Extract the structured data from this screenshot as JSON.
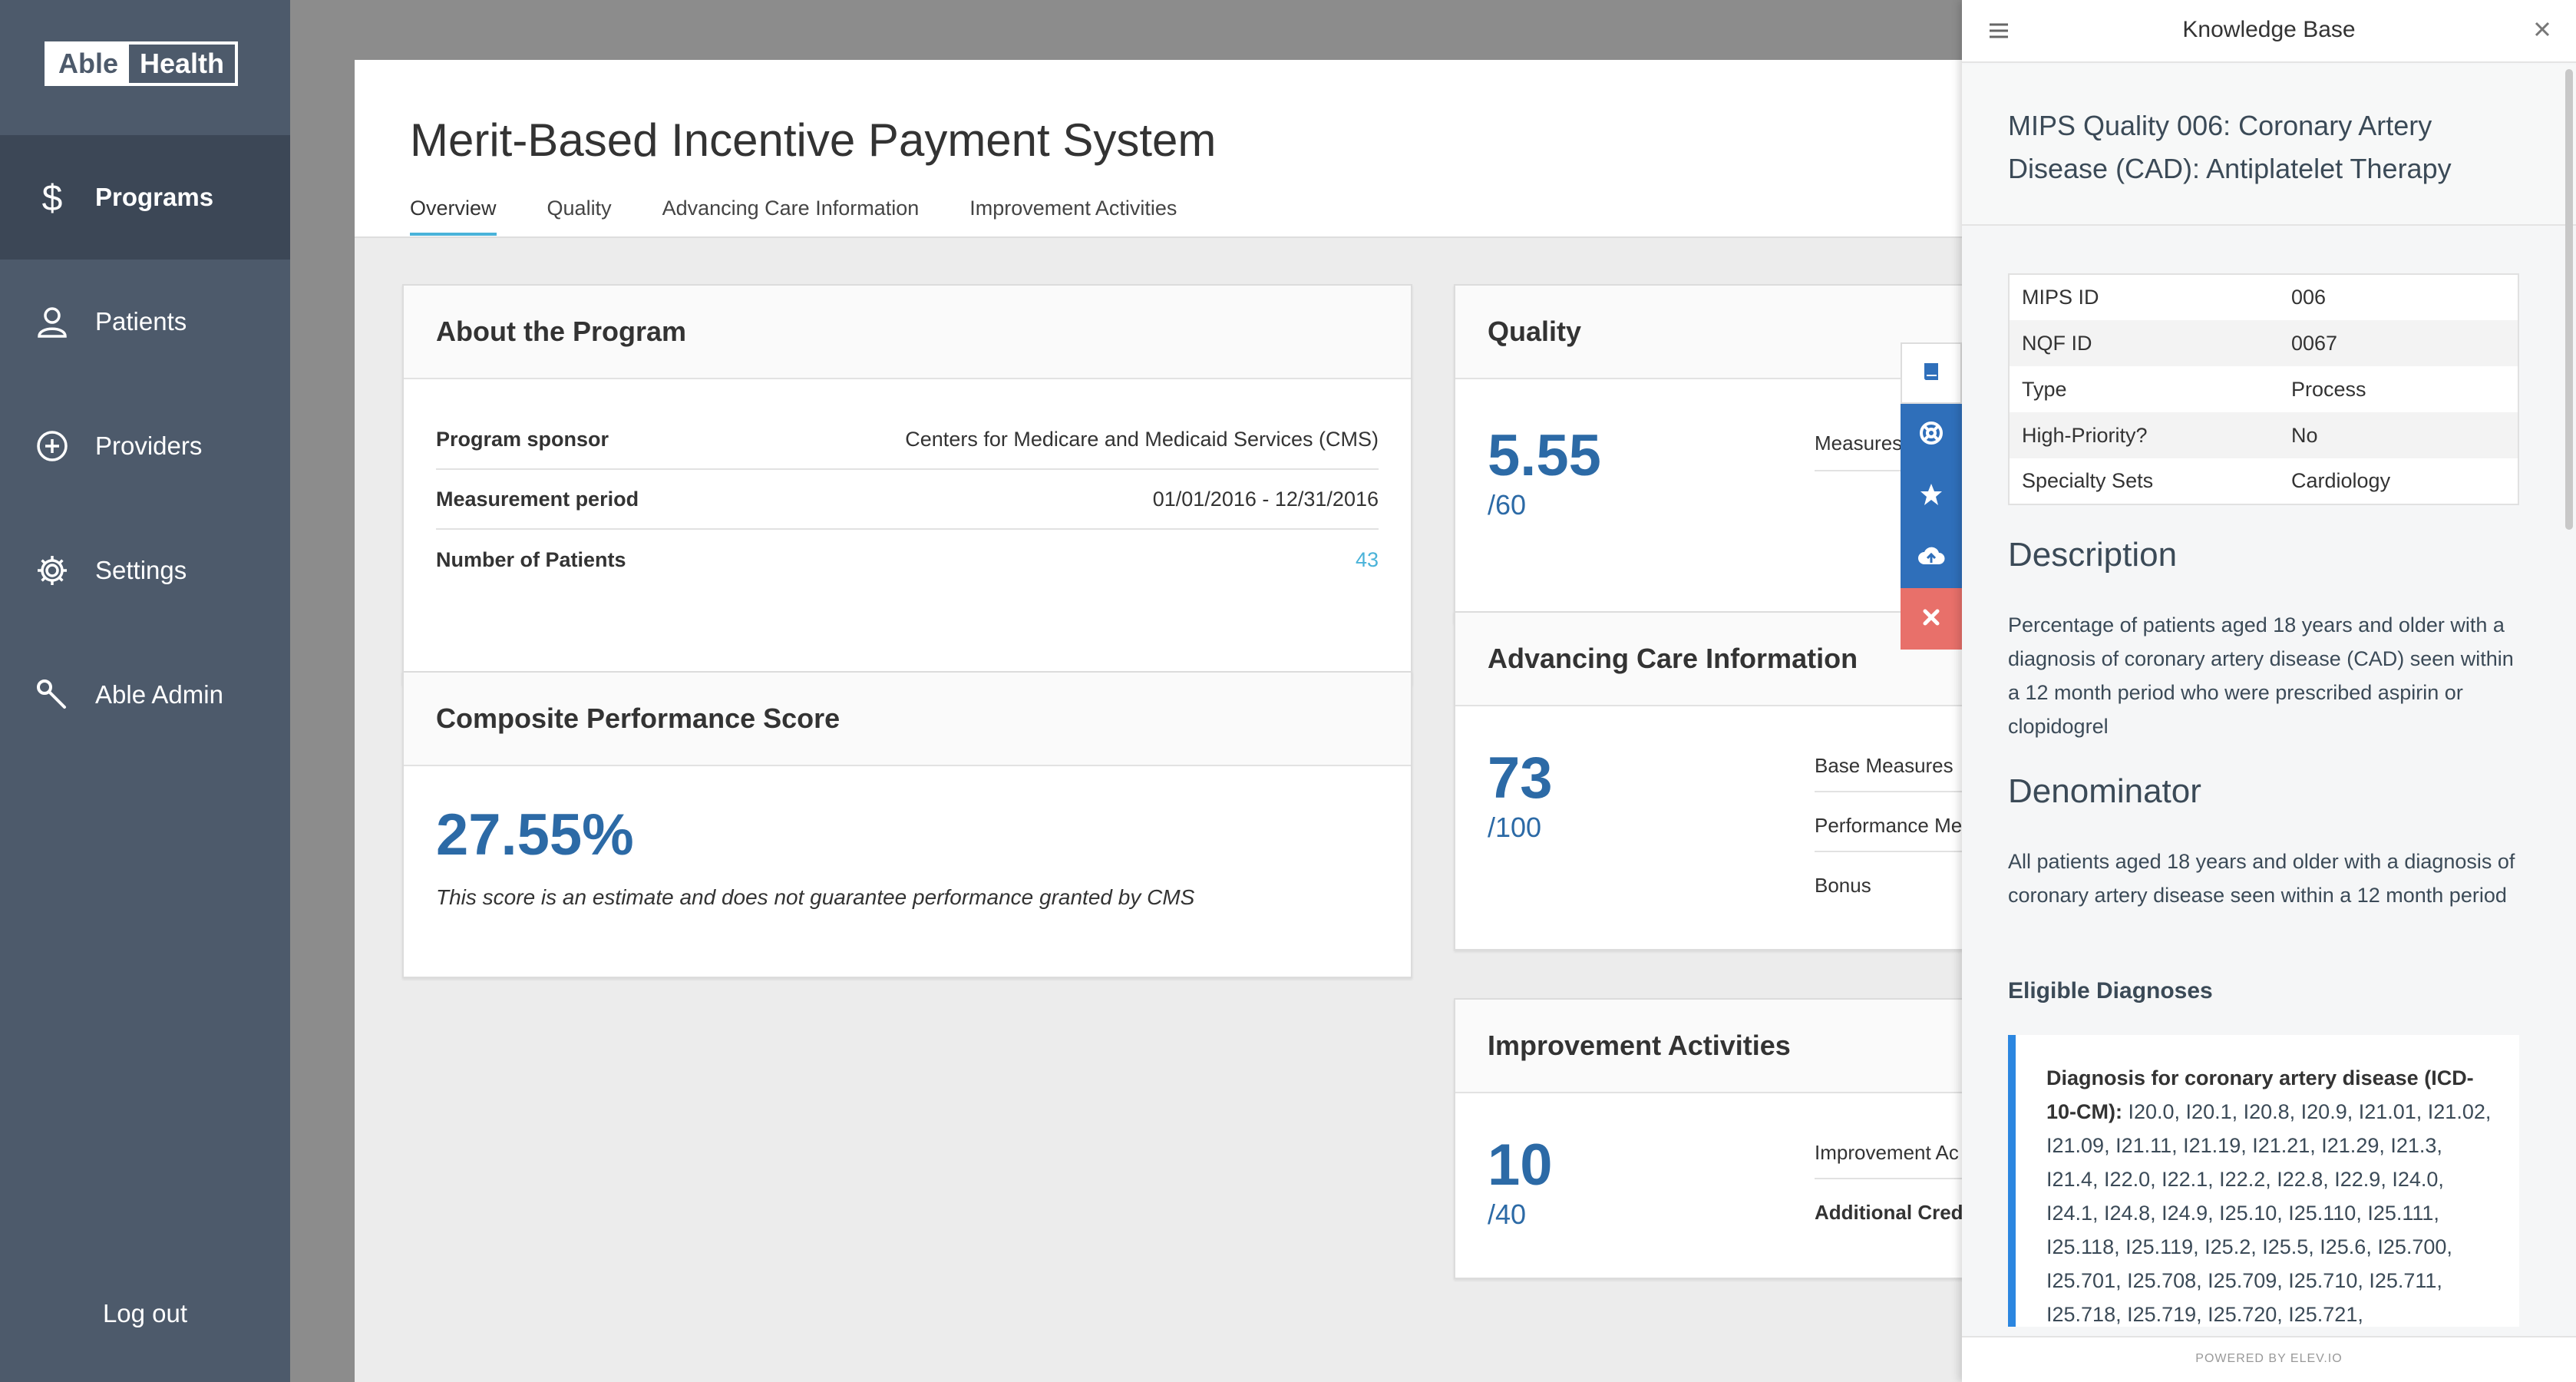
{
  "sidebar": {
    "logo": {
      "part1": "Able",
      "part2": "Health"
    },
    "items": [
      {
        "label": "Programs",
        "icon": "dollar-icon",
        "active": true
      },
      {
        "label": "Patients",
        "icon": "user-icon"
      },
      {
        "label": "Providers",
        "icon": "plus-circle-icon"
      },
      {
        "label": "Settings",
        "icon": "gear-icon"
      },
      {
        "label": "Able Admin",
        "icon": "wrench-icon"
      }
    ],
    "logout": "Log out"
  },
  "main": {
    "title": "Merit-Based Incentive Payment System",
    "tabs": [
      "Overview",
      "Quality",
      "Advancing Care Information",
      "Improvement Activities"
    ],
    "about": {
      "title": "About the Program",
      "rows": [
        {
          "label": "Program sponsor",
          "value": "Centers for Medicare and Medicaid Services (CMS)"
        },
        {
          "label": "Measurement period",
          "value": "01/01/2016 - 12/31/2016"
        },
        {
          "label": "Number of Patients",
          "value": "43"
        }
      ]
    },
    "composite": {
      "title": "Composite Performance Score",
      "score": "27.55%",
      "note": "This score is an estimate and does not guarantee performance granted by CMS"
    },
    "quality": {
      "title": "Quality",
      "score": "5.55",
      "denom": "/60",
      "sub": [
        "Measures"
      ]
    },
    "aci": {
      "title": "Advancing Care Information",
      "score": "73",
      "denom": "/100",
      "sub": [
        "Base Measures",
        "Performance Me",
        "Bonus"
      ]
    },
    "ia": {
      "title": "Improvement Activities",
      "score": "10",
      "denom": "/40",
      "sub": [
        "Improvement Ac",
        "Additional Credi"
      ]
    }
  },
  "toolbar": [
    {
      "icon": "book-icon",
      "color": "#ffffff"
    },
    {
      "icon": "lifebuoy-icon",
      "color": "#2f6fba"
    },
    {
      "icon": "star-icon",
      "color": "#2f6fba"
    },
    {
      "icon": "cloud-upload-icon",
      "color": "#2f6fba"
    },
    {
      "icon": "close-icon",
      "color": "#e8706a"
    }
  ],
  "kb": {
    "title": "Knowledge Base",
    "article_title": "MIPS Quality 006: Coronary Artery Disease (CAD): Antiplatelet Therapy",
    "table": [
      {
        "k": "MIPS ID",
        "v": "006"
      },
      {
        "k": "NQF ID",
        "v": "0067"
      },
      {
        "k": "Type",
        "v": "Process"
      },
      {
        "k": "High-Priority?",
        "v": "No"
      },
      {
        "k": "Specialty Sets",
        "v": "Cardiology"
      }
    ],
    "description_heading": "Description",
    "description": "Percentage of patients aged 18 years and older with a diagnosis of coronary artery disease (CAD) seen within a 12 month period who were prescribed aspirin or clopidogrel",
    "denominator_heading": "Denominator",
    "denominator": "All patients aged 18 years and older with a diagnosis of coronary artery disease seen within a 12 month period",
    "eligible_heading": "Eligible Diagnoses",
    "callout_label": "Diagnosis for coronary artery disease (ICD-10-CM):",
    "callout_codes": " I20.0, I20.1, I20.8, I20.9, I21.01, I21.02, I21.09, I21.11, I21.19, I21.21, I21.29, I21.3, I21.4, I22.0, I22.1, I22.2, I22.8, I22.9, I24.0, I24.1, I24.8, I24.9, I25.10, I25.110, I25.111, I25.118, I25.119, I25.2, I25.5, I25.6, I25.700, I25.701, I25.708, I25.709, I25.710, I25.711, I25.718, I25.719, I25.720, I25.721,",
    "footer": "POWERED BY ELEV.IO"
  },
  "colors": {
    "accent": "#4ab3d9",
    "score": "#2c6aa6",
    "sidebar": "#4d5a6b",
    "kb_bar": "#2b86e0"
  }
}
